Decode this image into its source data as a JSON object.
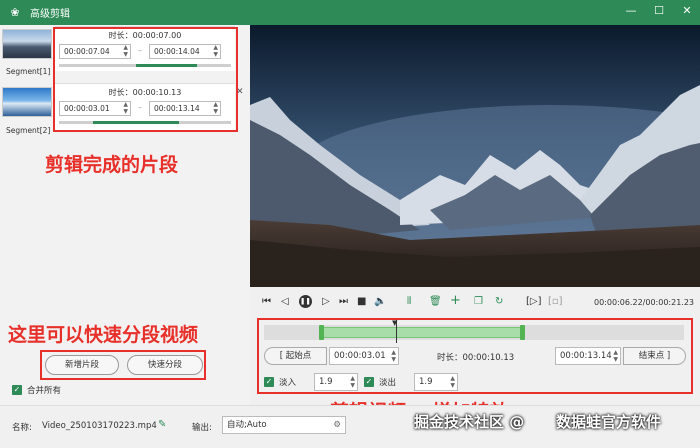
{
  "window": {
    "title": "高级剪辑",
    "minimize": "—",
    "maximize": "☐",
    "close": "✕"
  },
  "segments": [
    {
      "label": "Segment[1]",
      "duration_label": "时长：00:00:07.00",
      "start": "00:00:07.04",
      "end": "00:00:14.04"
    },
    {
      "label": "Segment[2]",
      "duration_label": "时长：00:00:10.13",
      "start": "00:00:03.01",
      "end": "00:00:13.14"
    }
  ],
  "annotations": {
    "segments_done": "剪辑完成的片段",
    "quick_split": "这里可以快速分段视频",
    "edit_effects": "剪辑视频    增加特效"
  },
  "left_panel": {
    "add_segment": "新增片段",
    "quick_split": "快速分段",
    "merge_all": "合并所有"
  },
  "player": {
    "timecode": "00:00:06.22/00:00:21.23"
  },
  "trim": {
    "start_btn": "[    起始点",
    "start_time": "00:00:03.01",
    "duration_label": "时长：00:00:10.13",
    "end_time": "00:00:13.14",
    "end_btn": "结束点    ]",
    "fade_in_label": "淡入",
    "fade_in_value": "1.9",
    "fade_out_label": "淡出",
    "fade_out_value": "1.9"
  },
  "bottom": {
    "name_label": "名称:",
    "name_value": "Video_250103170223.mp4",
    "output_label": "输出:",
    "output_value": "自动;Auto",
    "watermark_left": "掘金技术社区 @",
    "watermark_right": "数据蛙官方软件"
  },
  "colors": {
    "accent": "#2e8b57",
    "annotation": "#e8302a",
    "range": "#a8dca8"
  }
}
